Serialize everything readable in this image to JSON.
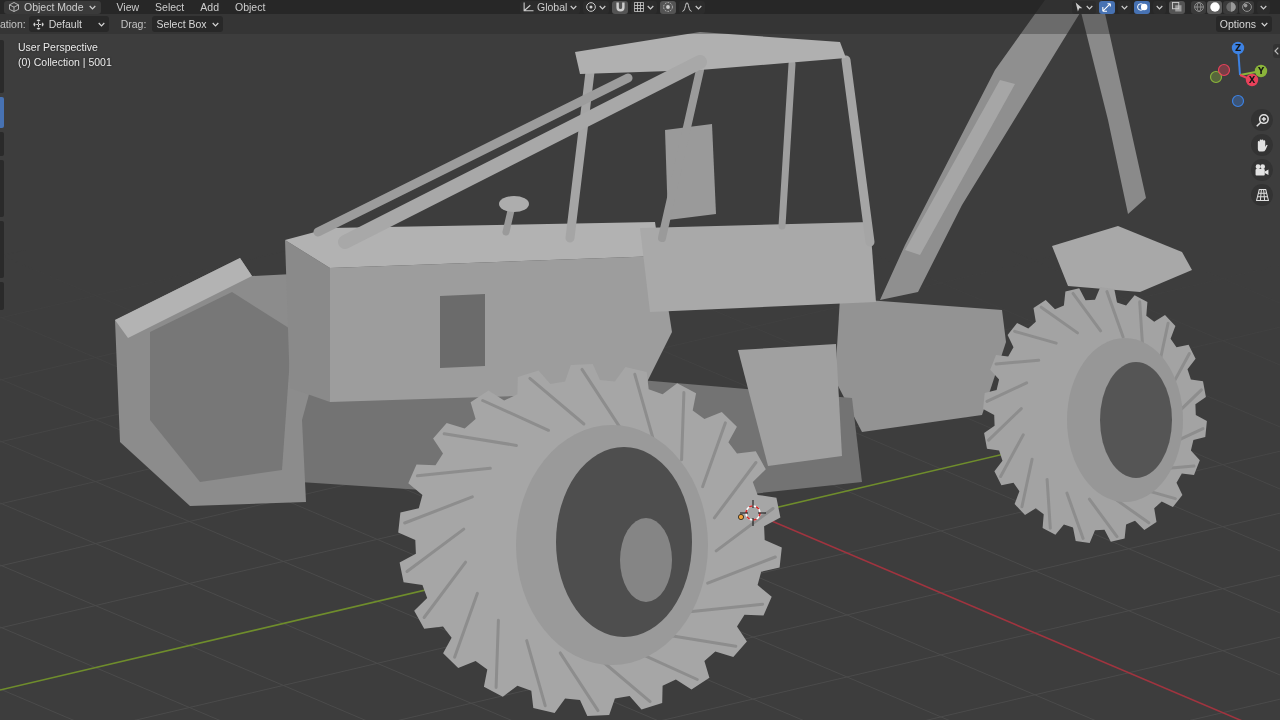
{
  "header": {
    "mode": "Object Mode",
    "menus": [
      "View",
      "Select",
      "Add",
      "Object"
    ],
    "orientation": "Global",
    "toggles": [
      {
        "kind": "snap",
        "on": false
      },
      {
        "kind": "proportional",
        "on": false
      }
    ],
    "overlays": [
      {
        "kind": "gizmo",
        "on": true
      },
      {
        "kind": "overlay",
        "on": true
      },
      {
        "kind": "xray",
        "on": false
      }
    ],
    "shading": [
      {
        "kind": "wireframe",
        "selected": false
      },
      {
        "kind": "solid",
        "selected": true
      },
      {
        "kind": "material",
        "selected": false
      },
      {
        "kind": "rendered",
        "selected": false
      }
    ]
  },
  "tool_settings": {
    "cut_label": "ation:",
    "cut_value": "Default",
    "drag_label": "Drag:",
    "drag": "Select Box",
    "options": "Options"
  },
  "toolbar": [
    {
      "selected": false
    },
    {
      "selected": true
    },
    {
      "selected": false
    },
    {
      "selected": false
    },
    {
      "selected": false
    },
    {
      "selected": false
    }
  ],
  "viewport": {
    "view": "User Perspective",
    "collection": "(0) Collection | 5001"
  },
  "navigation_gizmo": {
    "axes": [
      {
        "label": "Z",
        "color": "#3d82e3"
      },
      {
        "label": "Y",
        "color": "#8ab43a"
      },
      {
        "label": "X",
        "color": "#e8415a"
      }
    ]
  }
}
